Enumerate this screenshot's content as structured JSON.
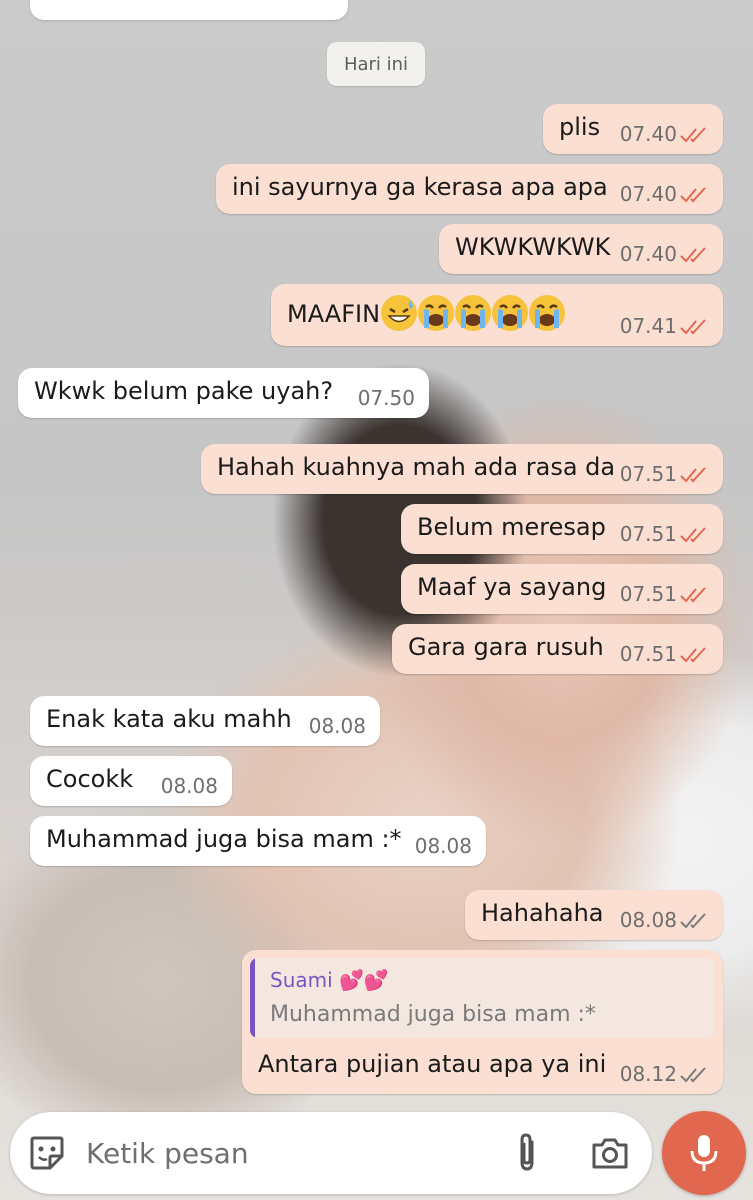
{
  "chat": {
    "date_chip": "Hari ini",
    "messages": [
      {
        "dir": "out",
        "text": "plis",
        "time": "07.40",
        "status": "read"
      },
      {
        "dir": "out",
        "text": "ini sayurnya ga kerasa apa apa",
        "time": "07.40",
        "status": "read"
      },
      {
        "dir": "out",
        "text": "WKWKWKWK",
        "time": "07.40",
        "status": "read"
      },
      {
        "dir": "out",
        "text": "MAAFIN",
        "emojis": [
          "grinning-sweat-emoji",
          "loudly-crying-emoji",
          "loudly-crying-emoji",
          "loudly-crying-emoji",
          "loudly-crying-emoji"
        ],
        "time": "07.41",
        "status": "read"
      },
      {
        "dir": "in",
        "text": "Wkwk belum pake uyah?",
        "time": "07.50"
      },
      {
        "dir": "out",
        "text": "Hahah kuahnya mah ada rasa da",
        "time": "07.51",
        "status": "read"
      },
      {
        "dir": "out",
        "text": "Belum meresap",
        "time": "07.51",
        "status": "read"
      },
      {
        "dir": "out",
        "text": "Maaf ya sayang",
        "time": "07.51",
        "status": "read"
      },
      {
        "dir": "out",
        "text": "Gara gara rusuh",
        "time": "07.51",
        "status": "read"
      },
      {
        "dir": "in",
        "text": "Enak kata aku mahh",
        "time": "08.08"
      },
      {
        "dir": "in",
        "text": "Cocokk",
        "time": "08.08"
      },
      {
        "dir": "in",
        "text": "Muhammad juga bisa mam :*",
        "time": "08.08"
      },
      {
        "dir": "out",
        "text": "Hahahaha",
        "time": "08.08",
        "status": "delivered"
      }
    ],
    "reply": {
      "quoted_name": "Suami 💕💕",
      "quoted_text": "Muhammad juga bisa mam :*",
      "text": "Antara pujian atau apa ya ini",
      "time": "08.12",
      "status": "delivered"
    }
  },
  "composer": {
    "placeholder": "Ketik pesan",
    "icons": [
      "sticker-icon",
      "paperclip-icon",
      "camera-icon",
      "mic-icon"
    ]
  },
  "colors": {
    "outgoing_bubble": "#fbdfd3",
    "incoming_bubble": "#ffffff",
    "read_ticks": "#e2674f",
    "delivered_ticks": "#7a7a7a",
    "quote_accent": "#7c53c3",
    "mic_button": "#e2674f"
  }
}
